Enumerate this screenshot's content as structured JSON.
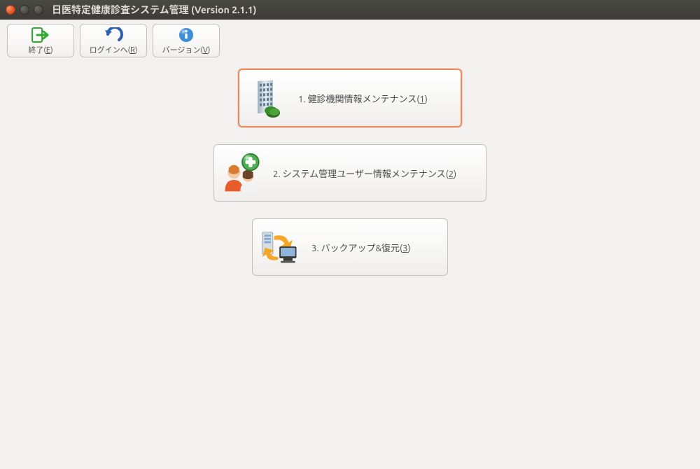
{
  "window": {
    "title": "日医特定健康診査システム管理 (Version 2.1.1)"
  },
  "toolbar": {
    "exit": {
      "label": "終了(",
      "accel": "E",
      "suffix": ")"
    },
    "login": {
      "label": "ログインへ(",
      "accel": "R",
      "suffix": ")"
    },
    "version": {
      "label": "バージョン(",
      "accel": "V",
      "suffix": ")"
    }
  },
  "menu": {
    "item1": {
      "prefix": "1. 健診機関情報メンテナンス(",
      "accel": "1",
      "suffix": ")"
    },
    "item2": {
      "prefix": "2. システム管理ユーザー情報メンテナンス(",
      "accel": "2",
      "suffix": ")"
    },
    "item3": {
      "prefix": "3. バックアップ&復元(",
      "accel": "3",
      "suffix": ")"
    }
  }
}
